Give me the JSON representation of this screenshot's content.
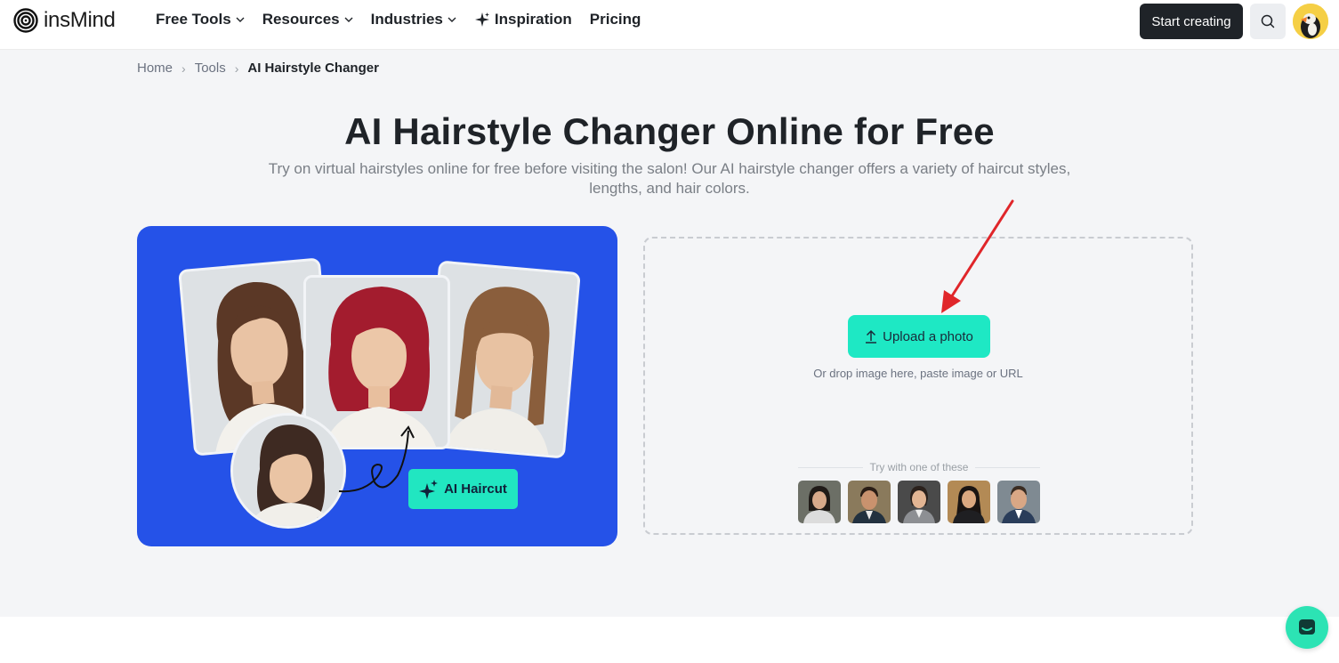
{
  "brand": {
    "name": "insMind"
  },
  "nav": {
    "items": [
      {
        "label": "Free Tools",
        "dropdown": true
      },
      {
        "label": "Resources",
        "dropdown": true
      },
      {
        "label": "Industries",
        "dropdown": true
      },
      {
        "label": "Inspiration",
        "icon": "sparkle-icon"
      },
      {
        "label": "Pricing"
      }
    ],
    "start_button": "Start creating"
  },
  "breadcrumb": {
    "home": "Home",
    "tools": "Tools",
    "current": "AI Hairstyle Changer"
  },
  "hero": {
    "title": "AI Hairstyle Changer Online for Free",
    "subtitle": "Try on virtual hairstyles online for free before visiting the salon! Our AI hairstyle changer offers a variety of haircut styles, lengths, and hair colors."
  },
  "demo": {
    "badge_label": "AI Haircut"
  },
  "upload": {
    "button_label": "Upload a photo",
    "hint": "Or drop image here, paste image or URL",
    "try_label": "Try with one of these",
    "samples": [
      "sample-woman-1",
      "sample-man-1",
      "sample-woman-2",
      "sample-woman-3",
      "sample-man-2"
    ]
  },
  "colors": {
    "accent": "#1ee8c4",
    "demo_bg": "#2552e8",
    "dark_button": "#1f2328",
    "annotation_arrow": "#e0262a"
  }
}
